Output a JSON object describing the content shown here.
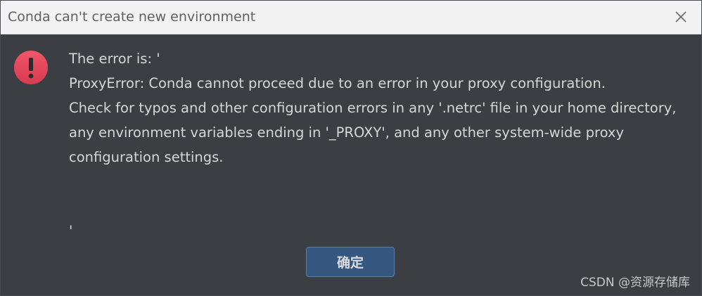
{
  "dialog": {
    "title": "Conda can't create new environment",
    "message_lines": [
      "The error is: '",
      "ProxyError: Conda cannot proceed due to an error in your proxy configuration.",
      "Check for typos and other configuration errors in any '.netrc' file in your home directory,",
      "any environment variables ending in '_PROXY', and any other system-wide proxy",
      "configuration settings.",
      "'"
    ],
    "ok_label": "确定",
    "icon": "error-icon",
    "close_icon": "close-icon"
  },
  "watermark": "CSDN @资源存储库",
  "colors": {
    "background": "#3b3e42",
    "titlebar": "#f2f2f2",
    "error_red": "#e8445a",
    "button_blue": "#365880",
    "text": "#d6d6d6"
  }
}
